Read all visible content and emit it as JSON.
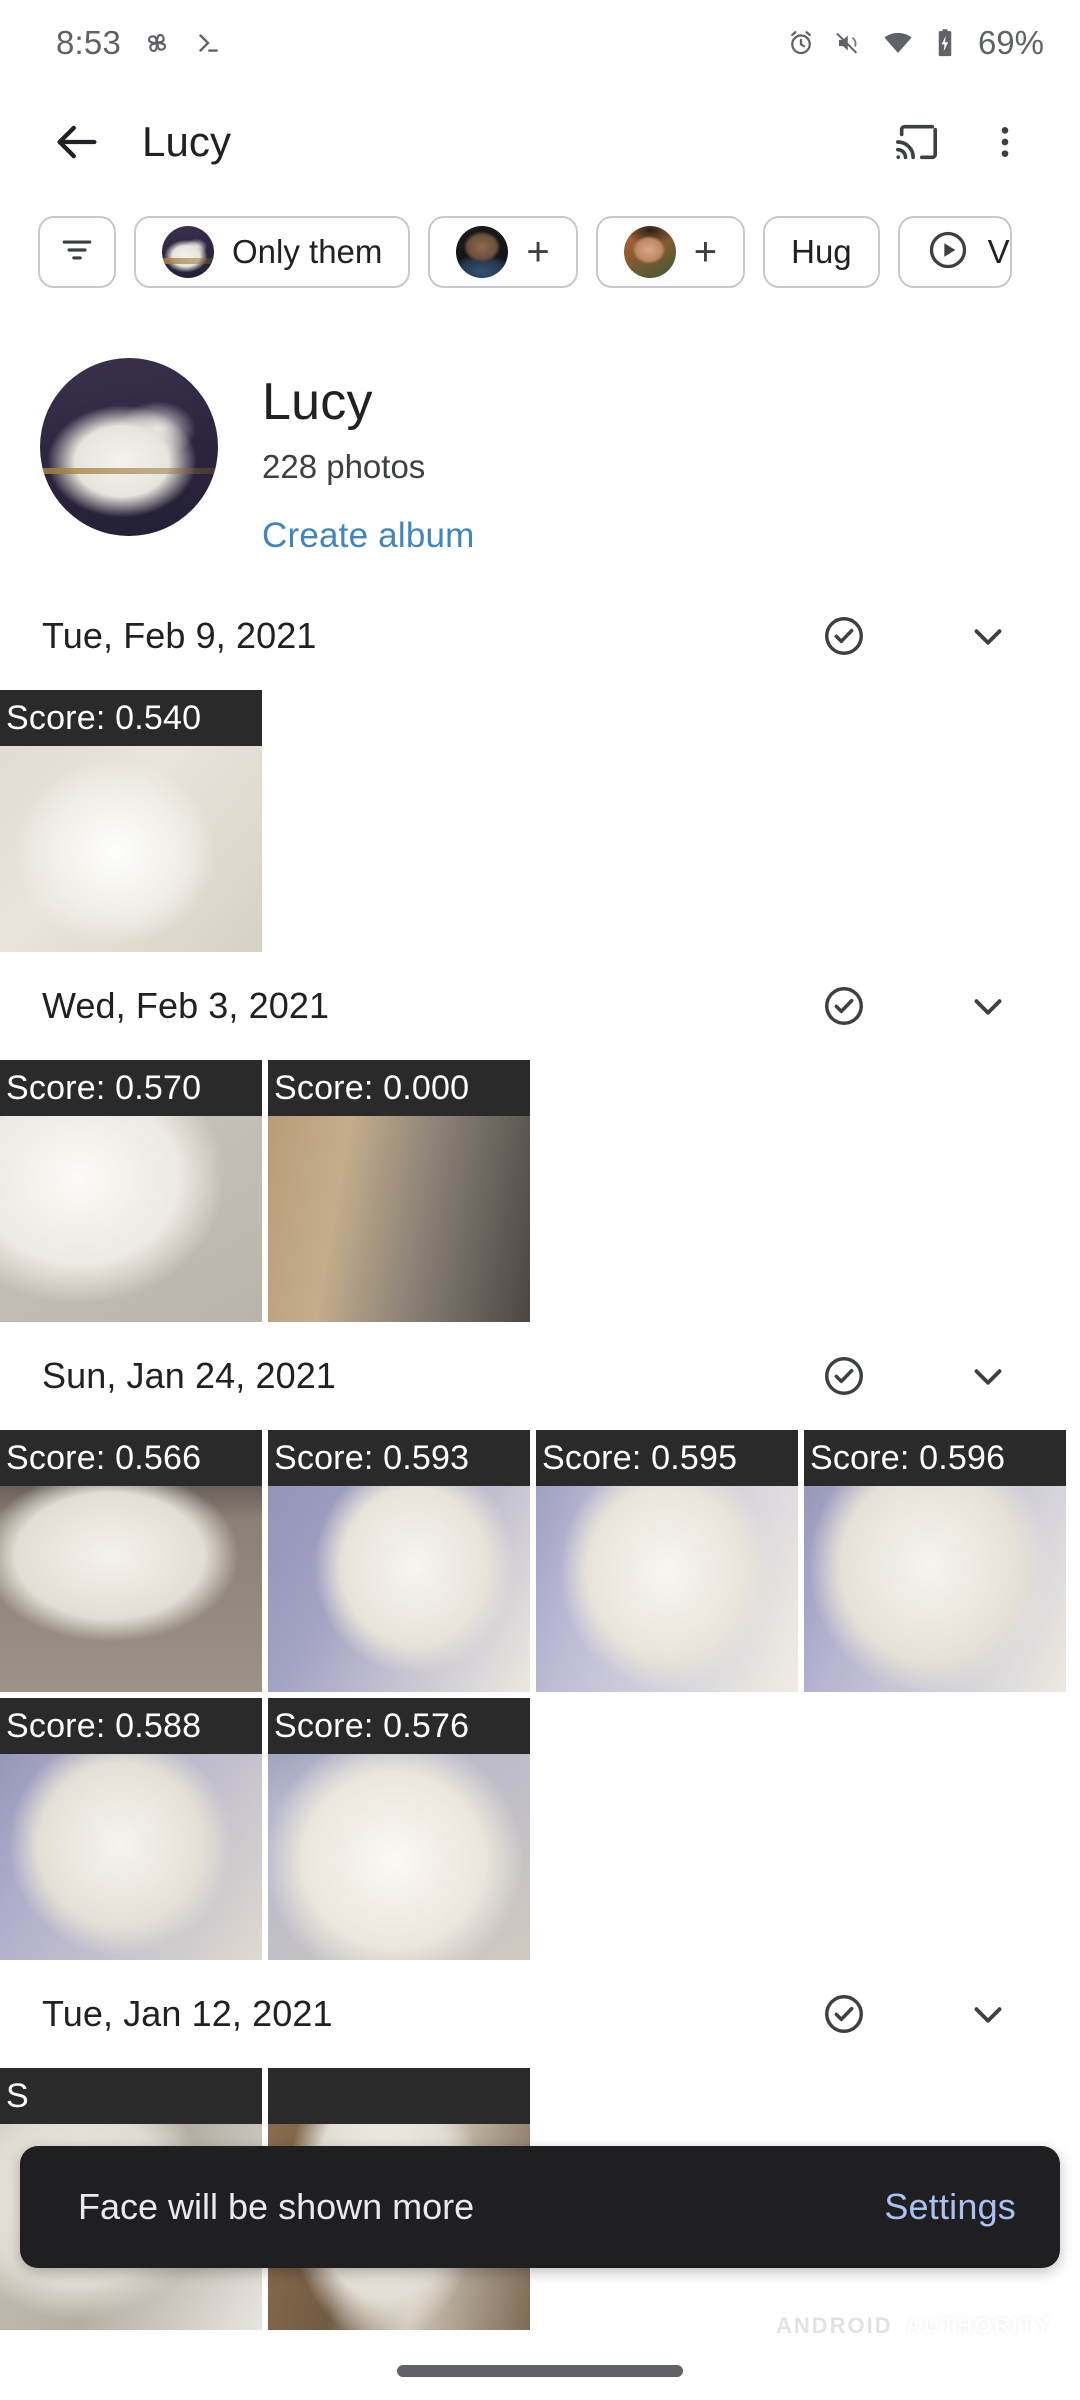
{
  "status_bar": {
    "time": "8:53",
    "left_icons": [
      "photos-pinwheel-icon",
      "terminal-icon"
    ],
    "right_icons": [
      "alarm-icon",
      "volume-muted-icon",
      "wifi-icon",
      "battery-charging-icon"
    ],
    "battery_percent": "69%"
  },
  "app_bar": {
    "back_icon": "back-arrow-icon",
    "title": "Lucy",
    "cast_icon": "cast-icon",
    "overflow_icon": "more-vert-icon"
  },
  "chips": [
    {
      "id": "filter",
      "type": "icon",
      "icon": "filter-icon",
      "label": ""
    },
    {
      "id": "only-them",
      "type": "avatar-label",
      "avatar": "av-dog",
      "label": "Only them"
    },
    {
      "id": "person-1",
      "type": "avatar-plus",
      "avatar": "av-man",
      "label": "+"
    },
    {
      "id": "person-2",
      "type": "avatar-plus",
      "avatar": "av-woman",
      "label": "+"
    },
    {
      "id": "hug",
      "type": "label",
      "label": "Hug"
    },
    {
      "id": "videos",
      "type": "icon-label",
      "icon": "play-circle-icon",
      "label": "V"
    }
  ],
  "profile": {
    "avatar": "av-dog",
    "name": "Lucy",
    "photo_count": "228 photos",
    "create_album_label": "Create album",
    "link_color": "#4285bd"
  },
  "sections": [
    {
      "date": "Tue, Feb 9, 2021",
      "select_icon": "check-circle-icon",
      "expand_icon": "chevron-down-icon",
      "photos": [
        {
          "score": "Score: 0.540",
          "art": "ph-a"
        }
      ]
    },
    {
      "date": "Wed, Feb 3, 2021",
      "select_icon": "check-circle-icon",
      "expand_icon": "chevron-down-icon",
      "photos": [
        {
          "score": "Score: 0.570",
          "art": "ph-b"
        },
        {
          "score": "Score: 0.000",
          "art": "ph-c"
        }
      ]
    },
    {
      "date": "Sun, Jan 24, 2021",
      "select_icon": "check-circle-icon",
      "expand_icon": "chevron-down-icon",
      "photos": [
        {
          "score": "Score: 0.566",
          "art": "ph-d"
        },
        {
          "score": "Score: 0.593",
          "art": "ph-e"
        },
        {
          "score": "Score: 0.595",
          "art": "ph-f"
        },
        {
          "score": "Score: 0.596",
          "art": "ph-g"
        },
        {
          "score": "Score: 0.588",
          "art": "ph-h"
        },
        {
          "score": "Score: 0.576",
          "art": "ph-i"
        }
      ]
    },
    {
      "date": "Tue, Jan 12, 2021",
      "select_icon": "check-circle-icon",
      "expand_icon": "chevron-down-icon",
      "photos": [
        {
          "score": "S",
          "art": "ph-k"
        },
        {
          "score": "",
          "art": "ph-l"
        }
      ]
    }
  ],
  "snackbar": {
    "message": "Face will be shown more",
    "action_label": "Settings",
    "background": "#1f1f21",
    "action_color": "#a9c2f5"
  },
  "watermark": {
    "part_one": "ANDROID",
    "part_two": "AUTHORITY"
  },
  "nav_bar": {
    "handle": "gesture-pill"
  }
}
